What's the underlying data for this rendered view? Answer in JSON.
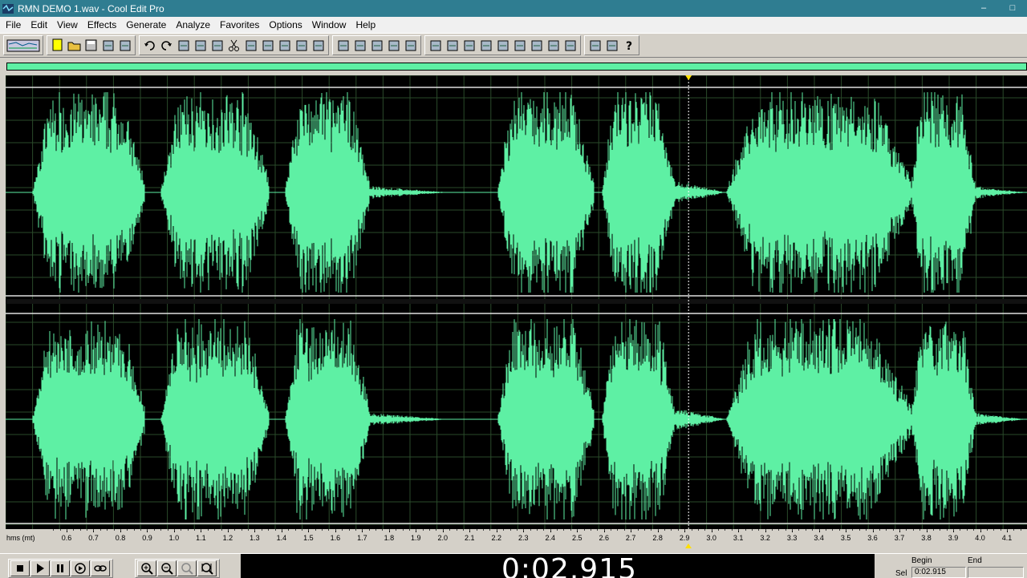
{
  "window": {
    "title": "RMN DEMO 1.wav - Cool Edit Pro",
    "app_icon": "cool-edit-icon"
  },
  "menu": [
    "File",
    "Edit",
    "View",
    "Effects",
    "Generate",
    "Analyze",
    "Favorites",
    "Options",
    "Window",
    "Help"
  ],
  "toolbar": {
    "groups": [
      [
        "multitrack-toggle-icon"
      ],
      [
        "new-file-icon",
        "open-folder-icon",
        "save-icon",
        "save-as-icon",
        "close-file-icon"
      ],
      [
        "undo-icon",
        "redo-icon",
        "repeat-icon",
        "copy-icon",
        "copy-to-new-icon",
        "cut-icon",
        "paste-icon",
        "paste-to-new-icon",
        "mix-paste-icon",
        "trim-icon",
        "select-all-icon"
      ],
      [
        "envelope-icon",
        "normalize-icon",
        "graph-icon",
        "spectral-icon",
        "fft-icon"
      ],
      [
        "waveform-view-icon",
        "spectral-view-icon",
        "cue-list-icon",
        "play-list-icon",
        "settings-icon",
        "time-format-icon",
        "grid-icon",
        "meter-icon",
        "info-icon"
      ],
      [
        "analyze-icon",
        "tools-icon",
        "help-icon"
      ]
    ]
  },
  "colors": {
    "waveform": "#5ef0a4",
    "background": "#000000",
    "grid": "#2a4a2a",
    "cursor": "#ffe000",
    "title_bar": "#2f7d91"
  },
  "ruler": {
    "unit_label": "hms (mt)",
    "ticks": [
      "0.6",
      "0.7",
      "0.8",
      "0.9",
      "1.0",
      "1.1",
      "1.2",
      "1.3",
      "1.4",
      "1.5",
      "1.6",
      "1.7",
      "1.8",
      "1.9",
      "2.0",
      "2.1",
      "2.2",
      "2.3",
      "2.4",
      "2.5",
      "2.6",
      "2.7",
      "2.8",
      "2.9",
      "3.0",
      "3.1",
      "3.2",
      "3.3",
      "3.4",
      "3.5",
      "3.6",
      "3.7",
      "3.8",
      "3.9",
      "4.0",
      "4.1"
    ],
    "start_seconds": 0.6,
    "end_seconds": 4.1,
    "cursor_seconds": 2.915
  },
  "transport": {
    "buttons": [
      "stop-icon",
      "play-icon",
      "pause-icon",
      "play-from-cursor-icon",
      "loop-icon"
    ],
    "zoom_buttons": [
      "zoom-in-icon",
      "zoom-out-icon",
      "zoom-full-icon",
      "zoom-selection-icon"
    ],
    "time_display": "0:02.915"
  },
  "selection": {
    "begin_label": "Begin",
    "end_label": "End",
    "sel_label": "Sel",
    "sel_begin": "0:02.915",
    "sel_end": ""
  }
}
